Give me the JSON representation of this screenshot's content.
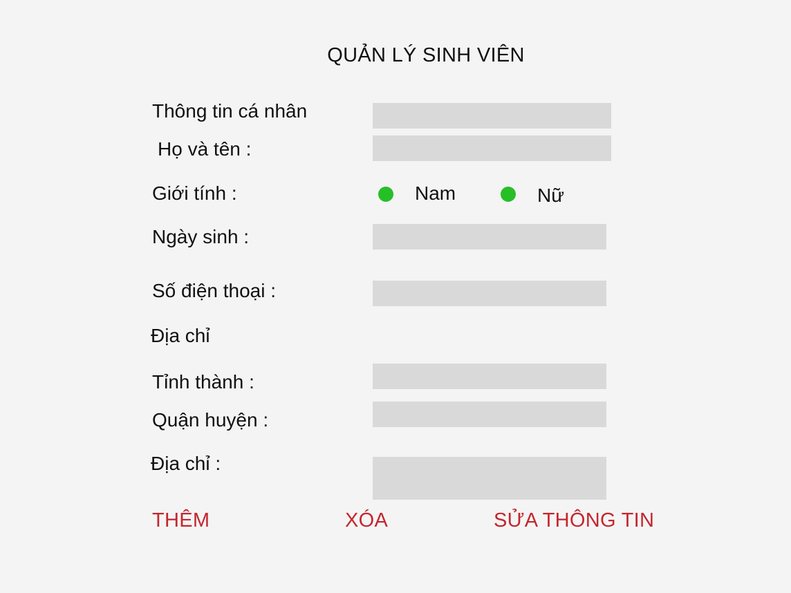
{
  "app": {
    "title": "QUẢN LÝ SINH VIÊN"
  },
  "form": {
    "personal_info_label": "Thông tin cá nhân",
    "name_label": "Họ và tên :",
    "gender_label": "Giới tính :",
    "gender_options": [
      {
        "label": "Nam",
        "color": "#27bf27"
      },
      {
        "label": "Nữ",
        "color": "#27bf27"
      }
    ],
    "birthdate_label": "Ngày sinh :",
    "phone_label": "Số điện thoại :",
    "address_section_label": "Địa chỉ",
    "province_label": "Tỉnh thành :",
    "district_label": "Quận huyện :",
    "address_label": "Địa chỉ :"
  },
  "actions": {
    "add_label": "THÊM",
    "delete_label": "XÓA",
    "edit_label": "SỬA THÔNG TIN",
    "color": "#c4262e"
  },
  "colors": {
    "background": "#f4f4f4",
    "field": "#d9d9d9",
    "radio": "#27bf27",
    "action": "#c4262e"
  }
}
